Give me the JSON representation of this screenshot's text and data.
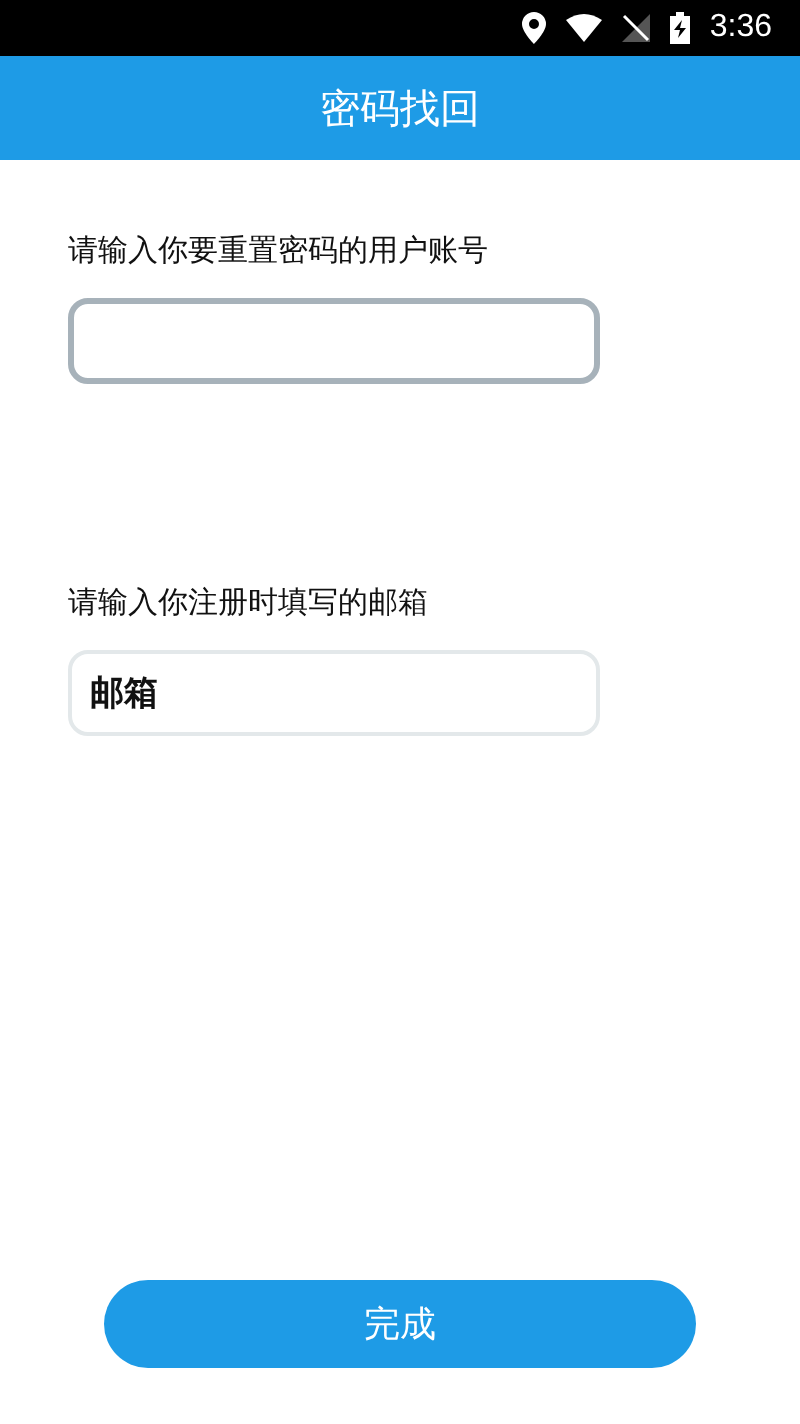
{
  "status_bar": {
    "time": "3:36"
  },
  "header": {
    "title": "密码找回"
  },
  "fields": [
    {
      "label": "请输入你要重置密码的用户账号",
      "focused": true
    },
    {
      "label": "请输入你注册时填写的邮箱",
      "value": "邮箱",
      "focused": false
    }
  ],
  "submit_button": "完成"
}
